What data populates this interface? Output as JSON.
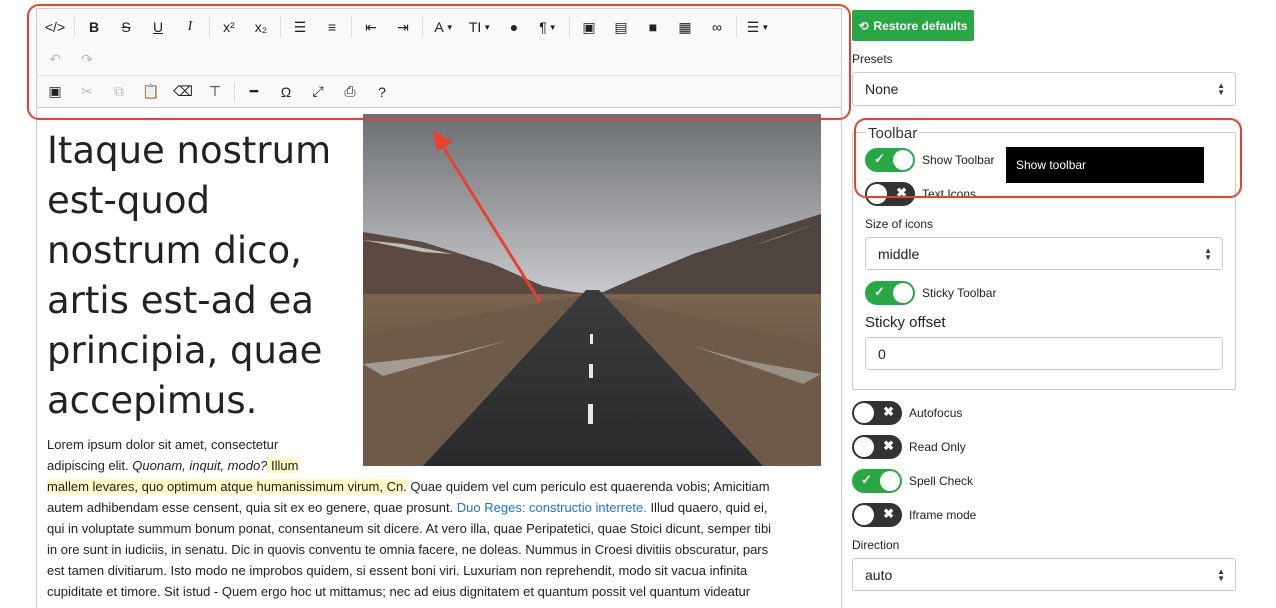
{
  "editor": {
    "toolbar": {
      "row1": [
        {
          "name": "source-icon",
          "glyph": "</>"
        },
        {
          "sep": true
        },
        {
          "name": "bold-icon",
          "glyph": "B"
        },
        {
          "name": "strikethrough-icon",
          "glyph": "S"
        },
        {
          "name": "underline-icon",
          "glyph": "U"
        },
        {
          "name": "italic-icon",
          "glyph": "I"
        },
        {
          "sep": true
        },
        {
          "name": "superscript-icon",
          "glyph": "x²"
        },
        {
          "name": "subscript-icon",
          "glyph": "x₂"
        },
        {
          "sep": true
        },
        {
          "name": "unordered-list-icon",
          "glyph": "☰"
        },
        {
          "name": "ordered-list-icon",
          "glyph": "≡"
        },
        {
          "sep": true
        },
        {
          "name": "outdent-icon",
          "glyph": "⇤"
        },
        {
          "name": "indent-icon",
          "glyph": "⇥"
        },
        {
          "sep": true
        },
        {
          "name": "font-icon",
          "glyph": "A"
        },
        {
          "name": "font-size-icon",
          "glyph": "TI"
        },
        {
          "name": "brush-color-icon",
          "glyph": "●"
        },
        {
          "name": "paragraph-icon",
          "glyph": "¶"
        },
        {
          "sep": true
        },
        {
          "name": "image-icon",
          "glyph": "▣"
        },
        {
          "name": "file-icon",
          "glyph": "▤"
        },
        {
          "name": "video-icon",
          "glyph": "■"
        },
        {
          "name": "table-icon",
          "glyph": "▦"
        },
        {
          "name": "link-icon",
          "glyph": "∞"
        },
        {
          "sep": true
        },
        {
          "name": "align-icon",
          "glyph": "☰"
        }
      ],
      "undo_glyph": "↶",
      "redo_glyph": "↷",
      "row3": [
        {
          "name": "select-all-icon",
          "glyph": "▣"
        },
        {
          "name": "cut-icon",
          "glyph": "✂"
        },
        {
          "name": "copy-icon",
          "glyph": "⧉"
        },
        {
          "name": "paste-icon",
          "glyph": "📋"
        },
        {
          "name": "eraser-icon",
          "glyph": "⌫"
        },
        {
          "name": "copyformat-icon",
          "glyph": "⊤"
        },
        {
          "sep": true
        },
        {
          "name": "horizontal-rule-icon",
          "glyph": "━"
        },
        {
          "name": "symbol-icon",
          "glyph": "Ω"
        },
        {
          "name": "fullsize-icon",
          "glyph": "⤢"
        },
        {
          "name": "print-icon",
          "glyph": "⎙"
        },
        {
          "name": "about-icon",
          "glyph": "?"
        }
      ]
    },
    "heading": "Itaque nostrum est-quod nostrum dico, artis est-ad ea principia, quae accepimus.",
    "paragraph": {
      "l1": "Lorem ipsum dolor sit amet, consectetur",
      "l2a": "adipiscing elit. ",
      "l2b": "Quonam, inquit, modo?",
      "l2c": " Illum",
      "l3a": "mallem levares, quo optimum atque humanissimum virum, Cn.",
      "l3b": " Quae quidem vel cum periculo est quaerenda vobis; Amicitiam",
      "l4a": "autem adhibendam esse censent, quia sit ex eo genere, quae prosunt. ",
      "l4link": "Duo Reges: constructio interrete.",
      "l4b": " Illud quaero, quid ei,",
      "l5": "qui in voluptate summum bonum ponat, consentaneum sit dicere. At vero illa, quae Peripatetici, quae Stoici dicunt, semper tibi",
      "l6": "in ore sunt in iudiciis, in senatu. Dic in quovis conventu te omnia facere, ne doleas. Nummus in Croesi divitiis obscuratur, pars",
      "l7": "est tamen divitiarum. Isto modo ne improbos quidem, si essent boni viri. Luxuriam non reprehendit, modo sit vacua infinita",
      "l8": "cupiditate et timore. Sit istud - Quem ergo hoc ut mittamus; nec ad eius dignitatem et quantum possit vel quantum videatur"
    }
  },
  "panel": {
    "restore_label": "Restore defaults",
    "presets_label": "Presets",
    "presets_value": "None",
    "toolbar_legend": "Toolbar",
    "show_toolbar": "Show Toolbar",
    "tooltip": "Show toolbar",
    "text_icons": "Text Icons",
    "size_label": "Size of icons",
    "size_value": "middle",
    "sticky_toolbar": "Sticky Toolbar",
    "sticky_offset_label": "Sticky offset",
    "sticky_offset_value": "0",
    "autofocus": "Autofocus",
    "read_only": "Read Only",
    "spell_check": "Spell Check",
    "iframe_mode": "Iframe mode",
    "direction_label": "Direction",
    "direction_value": "auto"
  },
  "colors": {
    "accent_green": "#28a745",
    "annotation_red": "#e8422f"
  }
}
